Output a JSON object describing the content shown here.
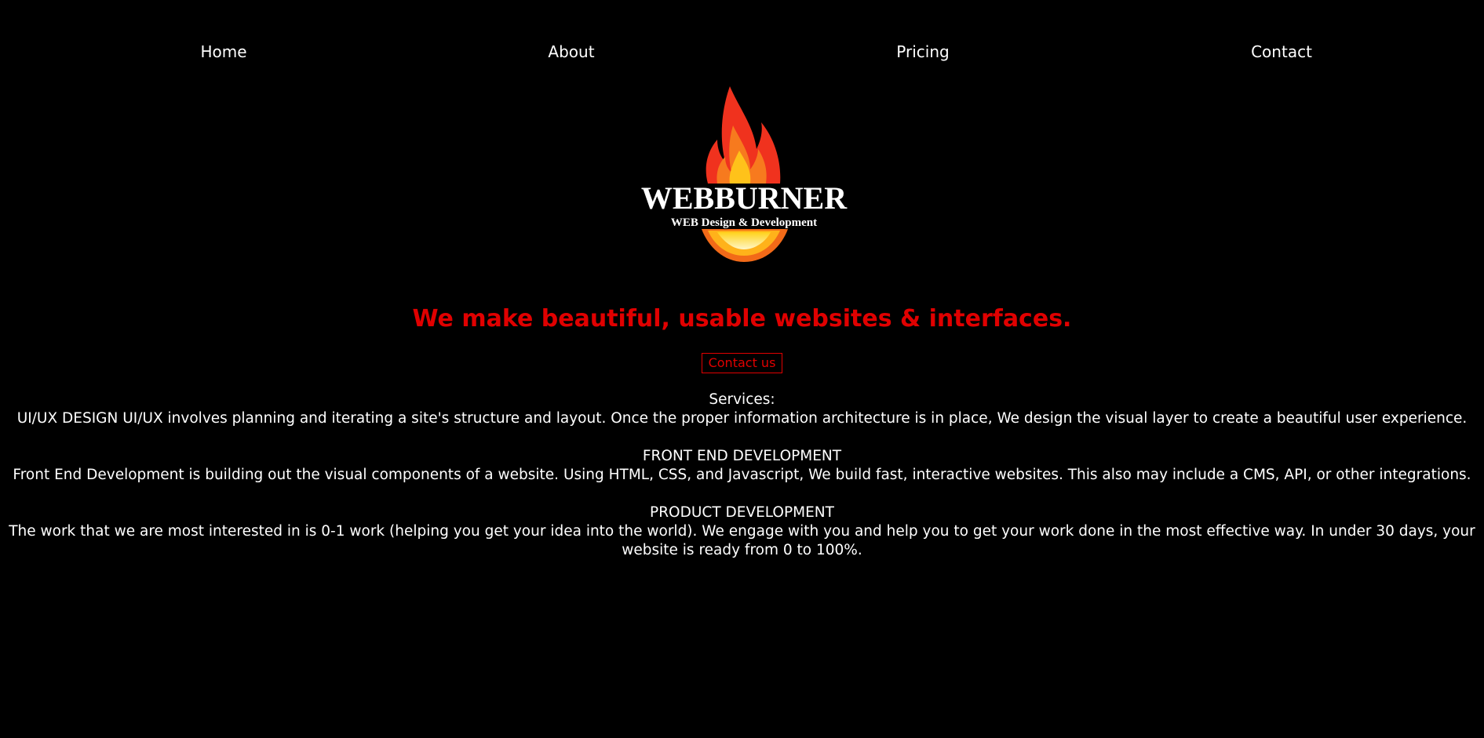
{
  "nav": {
    "items": [
      {
        "label": "Home"
      },
      {
        "label": "About"
      },
      {
        "label": "Pricing"
      },
      {
        "label": "Contact"
      }
    ]
  },
  "logo": {
    "wordmark": "WEBBURNER",
    "tagline": "WEB Design & Development",
    "icon": "flame-icon"
  },
  "hero": {
    "headline": "We make beautiful, usable websites & interfaces.",
    "cta_label": "Contact us"
  },
  "services": {
    "heading": "Services:",
    "items": [
      {
        "title": "UI/UX DESIGN",
        "description": "UI/UX involves planning and iterating a site's structure and layout. Once the proper information architecture is in place, We design the visual layer to create a beautiful user experience."
      },
      {
        "title": "FRONT END DEVELOPMENT",
        "description": "Front End Development is building out the visual components of a website. Using HTML, CSS, and Javascript, We build fast, interactive websites. This also may include a CMS, API, or other integrations."
      },
      {
        "title": "PRODUCT DEVELOPMENT",
        "description": "The work that we are most interested in is 0-1 work (helping you get your idea into the world). We engage with you and help you to get your work done in the most effective way. In under 30 days, your website is ready from 0 to 100%."
      }
    ]
  },
  "colors": {
    "background": "#000000",
    "text": "#ffffff",
    "accent": "#e00000"
  }
}
